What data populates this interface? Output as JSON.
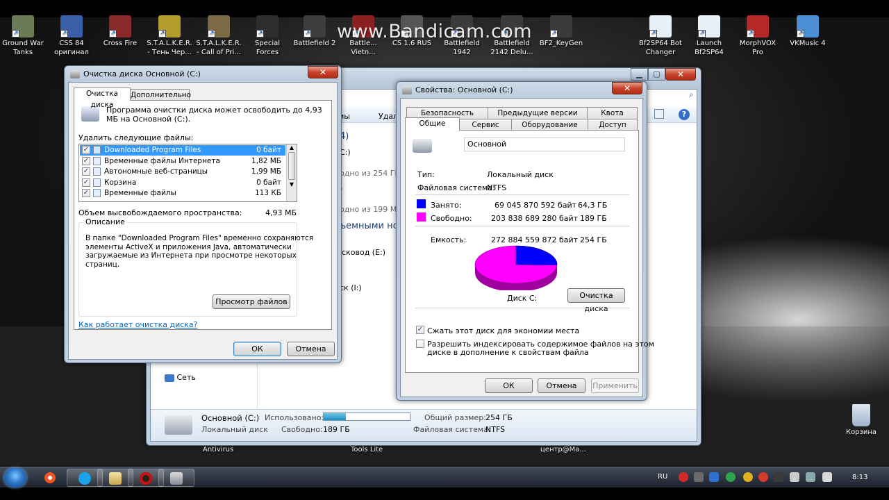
{
  "watermark": "www.Bandicam.com",
  "desktop_icons": [
    {
      "label": "Ground War\nTanks",
      "color": "#6b7b55"
    },
    {
      "label": "CSS 84\nоригинал",
      "color": "#3a5fa8"
    },
    {
      "label": "Cross Fire",
      "color": "#8a2a2a"
    },
    {
      "label": "S.T.A.L.K.E.R.\n- Тень Чер...",
      "color": "#b59a2c"
    },
    {
      "label": "S.T.A.L.K.E.R.\n- Call of Pri...",
      "color": "#7c6a45"
    },
    {
      "label": "Special\nForces",
      "color": "#2d2d2d"
    },
    {
      "label": "Battlefield 2",
      "color": "#3d3d3d"
    },
    {
      "label": "Battle...\nVietn...",
      "color": "#8b2020"
    },
    {
      "label": "CS 1.6 RUS",
      "color": "#555"
    },
    {
      "label": "Battlefield\n1942",
      "color": "#3b3b3b"
    },
    {
      "label": "Battlefield\n2142 Delu...",
      "color": "#3b3b3b"
    },
    {
      "label": "BF2_KeyGen",
      "color": "#3b3b3b"
    },
    {
      "label": "Bf2SP64 Bot\nChanger",
      "color": "#e8f0f8"
    },
    {
      "label": "Launch\nBf2SP64",
      "color": "#e8f0f8"
    },
    {
      "label": "MorphVOX\nPro",
      "color": "#b62828"
    },
    {
      "label": "VKMusic 4",
      "color": "#4a8fd6"
    }
  ],
  "recycle_bin_label": "Корзина",
  "behind_labels": {
    "antivirus": "Antivirus",
    "tools": "Tools Lite",
    "center": "центр@Ма..."
  },
  "explorer": {
    "toolbar_frag1": "мы",
    "toolbar_frag2": "Удал",
    "drives_count": "4)",
    "drive_c": "C:)",
    "free_c": "одно из 254 ГБ",
    "drive_d": ")",
    "free_d": "одно из 199 М",
    "removable": "ъемными но",
    "dvd": "ісковод (E:)",
    "disk_i": "ск (I:)",
    "network": "Сеть",
    "details": {
      "name": "Основной (C:)",
      "type": "Локальный диск",
      "used_label": "Использовано:",
      "free_label": "Свободно:",
      "free_value": "189 ГБ",
      "total_label": "Общий размер:",
      "total_value": "254 ГБ",
      "fs_label": "Файловая система:",
      "fs_value": "NTFS",
      "used_fraction": 0.26
    }
  },
  "cleanup": {
    "title": "Очистка диска Основной (C:)",
    "tabs": [
      "Очистка диска",
      "Дополнительно"
    ],
    "intro": "Программа очистки диска может освободить до 4,93\nМБ на Основной (C:).",
    "delete_label": "Удалить следующие файлы:",
    "files": [
      {
        "name": "Downloaded Program Files",
        "size": "0 байт",
        "checked": true,
        "selected": true
      },
      {
        "name": "Временные файлы Интернета",
        "size": "1,82 МБ",
        "checked": true,
        "selected": false
      },
      {
        "name": "Автономные веб-страницы",
        "size": "1,99 МБ",
        "checked": true,
        "selected": false
      },
      {
        "name": "Корзина",
        "size": "0 байт",
        "checked": true,
        "selected": false
      },
      {
        "name": "Временные файлы",
        "size": "113 КБ",
        "checked": true,
        "selected": false
      }
    ],
    "space_label": "Объем высвобождаемого пространства:",
    "space_value": "4,93 МБ",
    "description_title": "Описание",
    "description": "В папке \"Downloaded Program Files\" временно сохраняются\nэлементы ActiveX и приложения Java, автоматически\nзагружаемые из Интернета при просмотре некоторых\nстраниц.",
    "view_files_btn": "Просмотр файлов",
    "how_link": "Как работает очистка диска?",
    "ok": "ОК",
    "cancel": "Отмена"
  },
  "props": {
    "title": "Свойства: Основной (C:)",
    "tabs_top": [
      "Безопасность",
      "Предыдущие версии",
      "Квота"
    ],
    "tabs_bottom": [
      "Общие",
      "Сервис",
      "Оборудование",
      "Доступ"
    ],
    "name_value": "Основной",
    "type_label": "Тип:",
    "type_value": "Локальный диск",
    "fs_label": "Файловая система:",
    "fs_value": "NTFS",
    "used_label": "Занято:",
    "used_bytes": "69 045 870 592 байт",
    "used_gb": "64,3 ГБ",
    "free_label": "Свободно:",
    "free_bytes": "203 838 689 280 байт",
    "free_gb": "189 ГБ",
    "cap_label": "Емкость:",
    "cap_bytes": "272 884 559 872 байт",
    "cap_gb": "254 ГБ",
    "used_color": "#0000ff",
    "free_color": "#ff00ff",
    "used_fraction": 0.253,
    "disk_label": "Диск C:",
    "cleanup_btn": "Очистка диска",
    "compress_label": "Сжать этот диск для экономии места",
    "index_label": "Разрешить индексировать содержимое файлов на этом\nдиске в дополнение к свойствам файла",
    "compress_checked": true,
    "index_checked": false,
    "ok": "ОК",
    "cancel": "Отмена",
    "apply": "Применить"
  },
  "taskbar": {
    "lang": "RU",
    "clock": "8:13"
  }
}
